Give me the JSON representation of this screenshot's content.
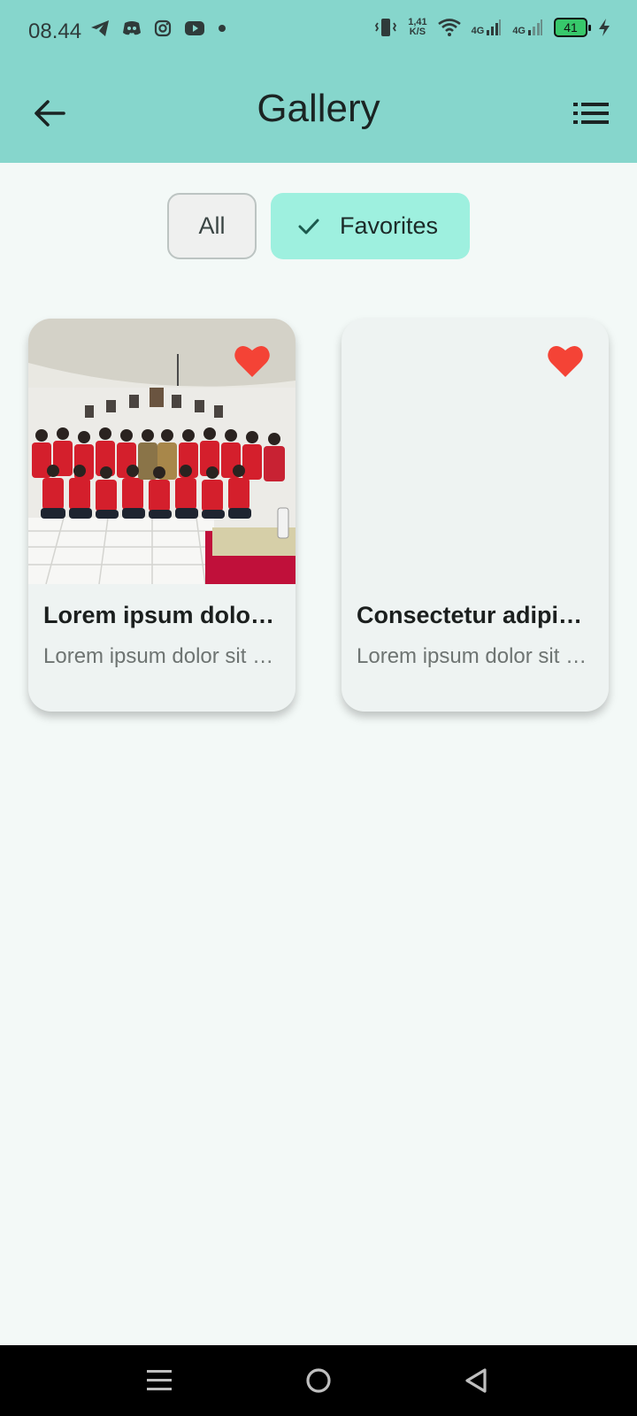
{
  "status": {
    "time": "08.44",
    "speed_top": "1,41",
    "speed_bottom": "K/S",
    "net1": "4G",
    "net2": "4G",
    "battery": "41"
  },
  "appbar": {
    "title": "Gallery"
  },
  "filters": {
    "all_label": "All",
    "favorites_label": "Favorites",
    "selected": "Favorites"
  },
  "cards": [
    {
      "title": "Lorem ipsum dolor sit amet",
      "description": "Lorem ipsum dolor sit amet, consectetur",
      "favorite": true
    },
    {
      "title": "Consectetur adipiscing elit",
      "description": "Lorem ipsum dolor sit amet, consectetur",
      "favorite": true
    }
  ],
  "colors": {
    "appbar": "#86d6cc",
    "chip_selected": "#9ef0df",
    "heart": "#f44336",
    "background": "#f3f9f7"
  }
}
